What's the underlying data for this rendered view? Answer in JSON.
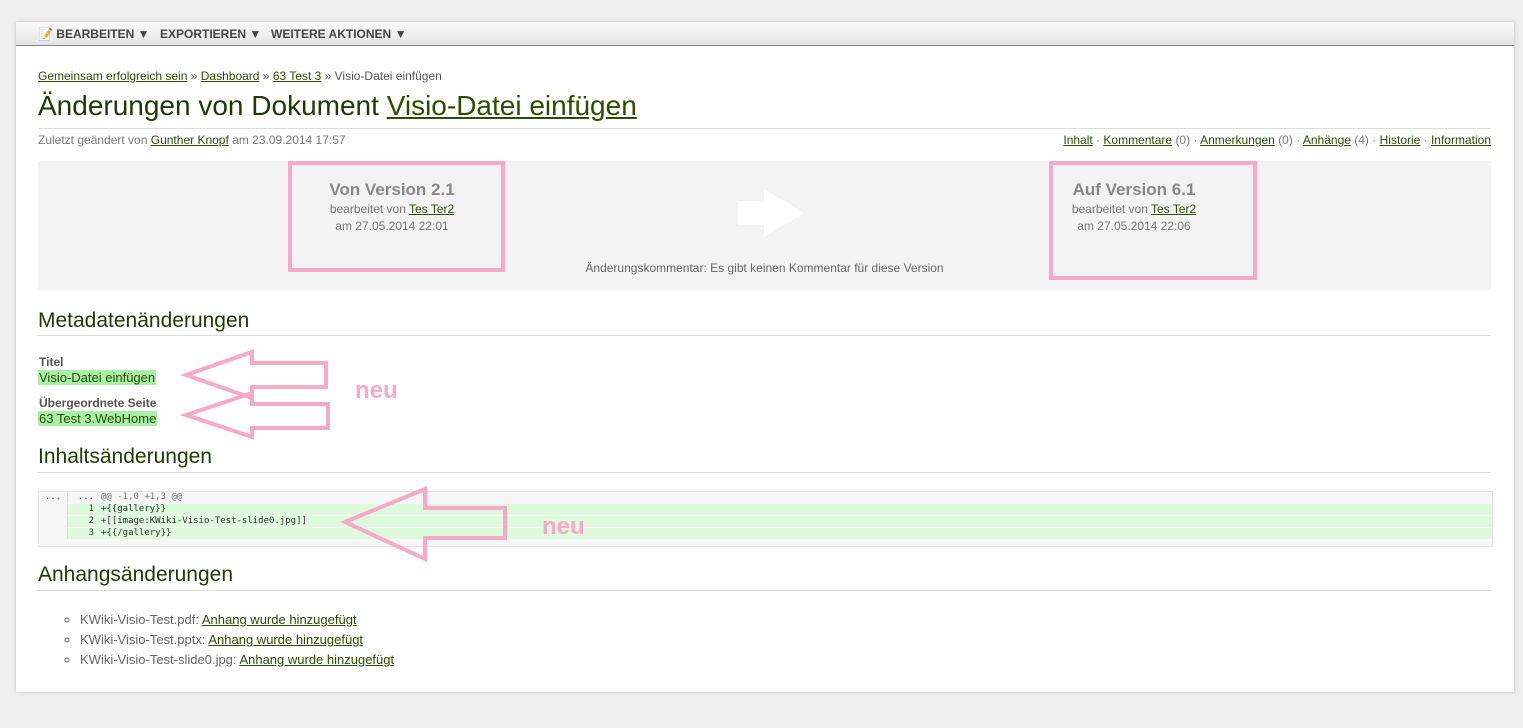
{
  "toolbar": {
    "items": [
      {
        "label": "BEARBEITEN",
        "icon": "pencil-icon"
      },
      {
        "label": "EXPORTIEREN"
      },
      {
        "label": "WEITERE AKTIONEN"
      }
    ]
  },
  "breadcrumb": {
    "items": [
      "Gemeinsam erfolgreich sein",
      "Dashboard",
      "63 Test 3"
    ],
    "current": "Visio-Datei einfügen",
    "sep": "»"
  },
  "title": {
    "prefix": "Änderungen von Dokument",
    "link": "Visio-Datei einfügen"
  },
  "meta": {
    "prefix": "Zuletzt geändert von",
    "author": "Gunther Knopf",
    "date": "am 23.09.2014 17:57"
  },
  "doc_links": [
    {
      "label": "Inhalt"
    },
    {
      "label": "Kommentare",
      "count": "(0)"
    },
    {
      "label": "Anmerkungen",
      "count": "(0)"
    },
    {
      "label": "Anhänge",
      "count": "(4)"
    },
    {
      "label": "Historie"
    },
    {
      "label": "Information"
    }
  ],
  "versions": {
    "from": {
      "title": "Von Version 2.1",
      "by": "bearbeitet von",
      "user": "Tes Ter2",
      "date": "am 27.05.2014 22:01"
    },
    "to": {
      "title": "Auf Version 6.1",
      "by": "bearbeitet von",
      "user": "Tes Ter2",
      "date": "am 27.05.2014 22:06"
    },
    "comment": "Änderungskommentar: Es gibt keinen Kommentar für diese Version"
  },
  "metadata": {
    "heading": "Metadatenänderungen",
    "fields": [
      {
        "label": "Titel",
        "value": "Visio-Datei einfügen"
      },
      {
        "label": "Übergeordnete Seite",
        "value": "63 Test 3.WebHome"
      }
    ]
  },
  "content": {
    "heading": "Inhaltsänderungen",
    "rows": [
      {
        "n1": "...",
        "n2": "...",
        "code": "@@ -1,0 +1,3 @@"
      },
      {
        "n1": "",
        "n2": "1",
        "code": "+{{gallery}}"
      },
      {
        "n1": "",
        "n2": "2",
        "code": "+[[image:KWiki-Visio-Test-slide0.jpg]]"
      },
      {
        "n1": "",
        "n2": "3",
        "code": "+{{/gallery}}"
      }
    ]
  },
  "attachments": {
    "heading": "Anhangsänderungen",
    "items": [
      {
        "file": "KWiki-Visio-Test.pdf:",
        "action": "Anhang wurde hinzugefügt"
      },
      {
        "file": "KWiki-Visio-Test.pptx:",
        "action": "Anhang wurde hinzugefügt"
      },
      {
        "file": "KWiki-Visio-Test-slide0.jpg:",
        "action": "Anhang wurde hinzugefügt"
      }
    ]
  },
  "annotations": {
    "label1": "neu",
    "label2": "neu",
    "color": "#f7a9c7"
  }
}
